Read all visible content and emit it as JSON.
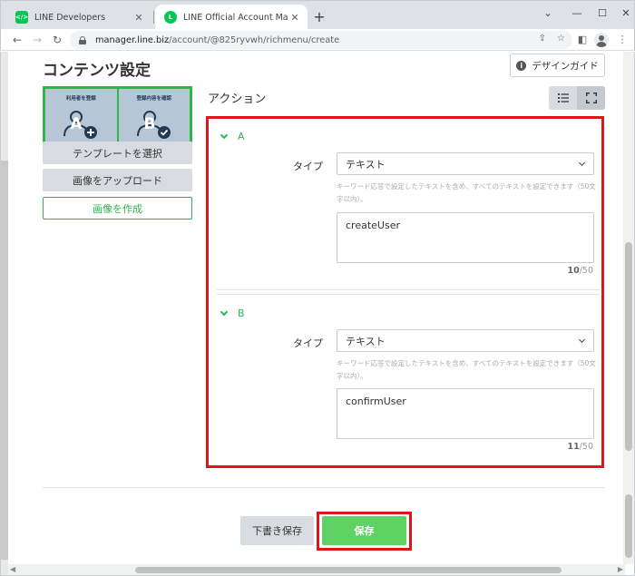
{
  "browser": {
    "tabs": [
      {
        "title": "LINE Developers",
        "favicon": "line-developers-icon",
        "active": false
      },
      {
        "title": "LINE Official Account Manager",
        "favicon": "line-oa-icon",
        "active": true
      }
    ],
    "url_host": "manager.line.biz",
    "url_path": "/account/@825ryvwh/richmenu/create"
  },
  "page": {
    "title": "コンテンツ設定",
    "design_guide_label": "デザインガイド"
  },
  "richmenu": {
    "cells": [
      {
        "label": "利用者を登録",
        "letter": "A",
        "icon": "user-add-icon"
      },
      {
        "label": "登録内容を確認",
        "letter": "B",
        "icon": "user-check-icon"
      }
    ],
    "select_template_label": "テンプレートを選択",
    "upload_image_label": "画像をアップロード",
    "create_image_label": "画像を作成"
  },
  "actions": {
    "title": "アクション",
    "items": [
      {
        "letter": "A",
        "type_label": "タイプ",
        "type_value": "テキスト",
        "hint": "キーワード応答で設定したテキストを含め、すべてのテキストを設定できます（50文字以内）。",
        "text": "createUser",
        "count": "10",
        "max": "/50"
      },
      {
        "letter": "B",
        "type_label": "タイプ",
        "type_value": "テキスト",
        "hint": "キーワード応答で設定したテキストを含め、すべてのテキストを設定できます（50文字以内）。",
        "text": "confirmUser",
        "count": "11",
        "max": "/50"
      }
    ]
  },
  "footer": {
    "draft_label": "下書き保存",
    "save_label": "保存"
  },
  "colors": {
    "line_green": "#2db84a",
    "save_green": "#5fd165",
    "highlight_red": "#e0151b"
  }
}
